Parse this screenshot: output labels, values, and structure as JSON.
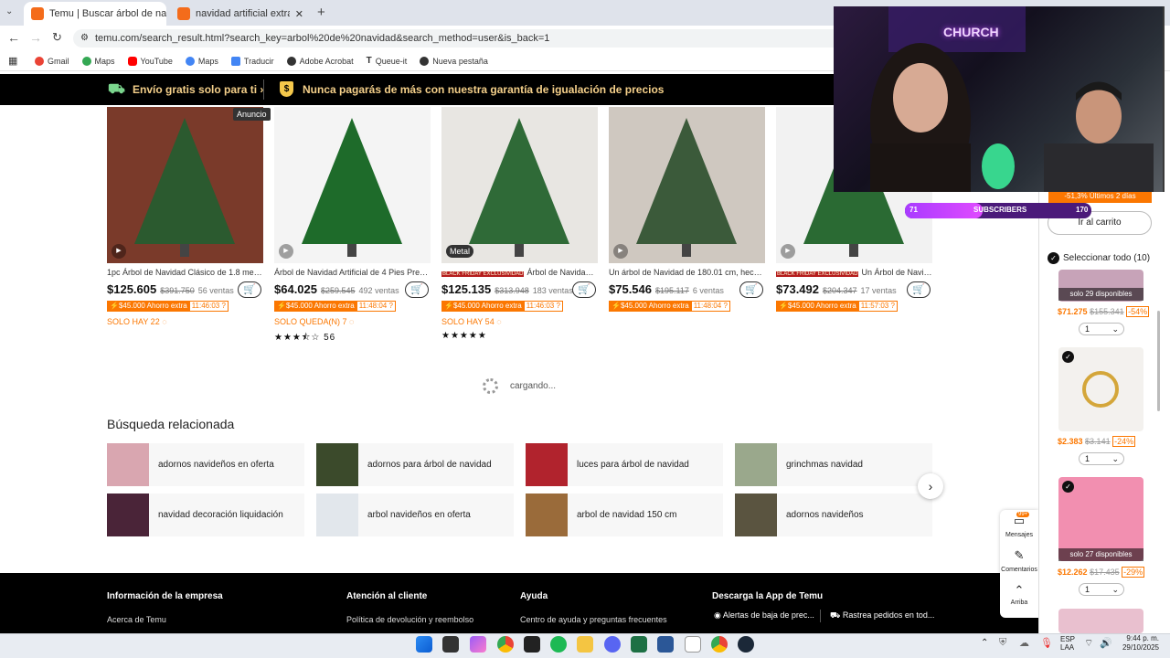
{
  "browser": {
    "tabs": [
      {
        "label": "Temu | Buscar árbol de navidad",
        "active": true
      },
      {
        "label": "navidad artificial extra base - Te",
        "active": false
      }
    ],
    "url": "temu.com/search_result.html?search_key=arbol%20de%20navidad&search_method=user&is_back=1",
    "bookmarks": [
      "Gmail",
      "Maps",
      "YouTube",
      "Maps",
      "Traducir",
      "Adobe Acrobat",
      "Queue-it",
      "Nueva pestaña"
    ]
  },
  "banner": {
    "left": "Envío gratis solo para ti",
    "right": "Nunca pagarás de más con nuestra garantía de igualación de precios"
  },
  "products": [
    {
      "title": "1pc Árbol de Navidad Clásico de 1.8 metro...",
      "price_whole": "125.605",
      "old_price": "$391.750",
      "sales": "56 ventas",
      "savings": "$45.000 Ahorro extra",
      "timer": "11:46:03",
      "stock": "SOLO HAY 22",
      "badge": "Anuncio",
      "tag": "",
      "black_friday": false,
      "rating_count": "",
      "full_stars": 0
    },
    {
      "title": "Árbol de Navidad Artificial de 4 Pies Pre-ill...",
      "price_whole": "64.025",
      "old_price": "$259.545",
      "sales": "492 ventas",
      "savings": "$45.000 Ahorro extra",
      "timer": "11:48:04",
      "stock": "SOLO QUEDA(N) 7",
      "badge": "",
      "tag": "",
      "black_friday": false,
      "rating_count": "56",
      "full_stars": 3.5
    },
    {
      "title": "Árbol de Navidad artificial extra ...",
      "price_whole": "125.135",
      "old_price": "$313.948",
      "sales": "183 ventas",
      "savings": "$45.000 Ahorro extra",
      "timer": "11:46:03",
      "stock": "SOLO HAY 54",
      "badge": "",
      "tag": "Metal",
      "black_friday": true,
      "rating_count": "",
      "full_stars": 5
    },
    {
      "title": "Un árbol de Navidad de 180.01 cm, hecho ...",
      "price_whole": "75.546",
      "old_price": "$195.117",
      "sales": "6 ventas",
      "savings": "$45.000 Ahorro extra",
      "timer": "11:48:04",
      "stock": "",
      "badge": "",
      "tag": "",
      "black_friday": false,
      "rating_count": "",
      "full_stars": 0
    },
    {
      "title": "Un Árbol de Navidad Clásico Di...",
      "price_whole": "73.492",
      "old_price": "$204.347",
      "sales": "17 ventas",
      "savings": "$45.000 Ahorro extra",
      "timer": "11:57:03",
      "stock": "",
      "badge": "",
      "tag": "",
      "black_friday": true,
      "rating_count": "",
      "full_stars": 0
    }
  ],
  "black_friday_label": "BLACK FRIDAY EXCLUSIVIDAD",
  "loading_text": "cargando...",
  "related": {
    "title": "Búsqueda relacionada",
    "items": [
      "adornos navideños en oferta",
      "adornos para árbol de navidad",
      "luces para árbol de navidad",
      "grinchmas navidad",
      "navidad decoración liquidación",
      "arbol navideños en oferta",
      "arbol de navidad 150 cm",
      "adornos navideños"
    ]
  },
  "footer": {
    "cols": [
      {
        "title": "Información de la empresa",
        "link": "Acerca de Temu"
      },
      {
        "title": "Atención al cliente",
        "link": "Política de devolución y reembolso"
      },
      {
        "title": "Ayuda",
        "link": "Centro de ayuda y preguntas frecuentes"
      },
      {
        "title": "Descarga la App de Temu",
        "link": "Alertas de baja de prec..."
      }
    ],
    "extra": "Rastrea pedidos en tod..."
  },
  "cart_sidebar": {
    "header_discount": "-51,3% Últimos 2 días",
    "go_cart": "Ir al carrito",
    "select_all": "Seleccionar todo (10)",
    "items": [
      {
        "stock": "solo 29 disponibles",
        "price": "$71.275",
        "old": "$155.341",
        "pct": "-54%",
        "qty": "1"
      },
      {
        "stock": "",
        "price": "$2.383",
        "old": "$3.141",
        "pct": "-24%",
        "qty": "1"
      },
      {
        "stock": "solo 27 disponibles",
        "price": "$12.262",
        "old": "$17.435",
        "pct": "-29%",
        "qty": "1"
      }
    ]
  },
  "float_menu": {
    "messages": "Mensajes",
    "badge": "99+",
    "comments": "Comentarios",
    "top": "Arriba"
  },
  "stream": {
    "bar_left": "71",
    "bar_label": "SUBSCRIBERS",
    "bar_right": "170",
    "neon": "CHURCH"
  },
  "taskbar": {
    "lang1": "ESP",
    "lang2": "LAA",
    "time": "9:44 p. m.",
    "date": "29/10/2025"
  }
}
